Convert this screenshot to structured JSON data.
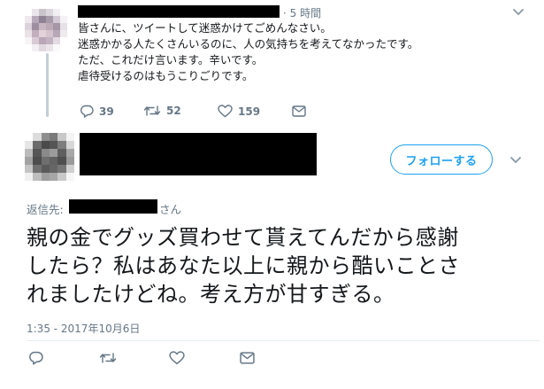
{
  "parent_tweet": {
    "time": "· 5 時間",
    "lines": [
      "皆さんに、ツイートして迷惑かけてごめんなさい。",
      "迷惑かかる人たくさんいるのに、人の気持ちを考えてなかったです。",
      "ただ、これだけ言います。辛いです。",
      "虐待受けるのはもうこりごりです。"
    ],
    "actions": {
      "replies": "39",
      "retweets": "52",
      "likes": "159"
    }
  },
  "reply_tweet": {
    "follow_label": "フォローする",
    "reply_to_label": "返信先:",
    "reply_to_suffix": "さん",
    "lines": [
      "親の金でグッズ買わせて貰えてんだから感謝",
      "したら？私はあなた以上に親から酷いことさ",
      "れましたけどね。考え方が甘すぎる。"
    ],
    "timestamp": "1:35 - 2017年10月6日"
  },
  "colors": {
    "accent": "#1da1f2",
    "muted": "#657786",
    "text": "#14171a",
    "thread_line": "#c4cfd6"
  },
  "icons": [
    "reply-icon",
    "retweet-icon",
    "like-icon",
    "dm-icon",
    "chevron-down-icon"
  ]
}
